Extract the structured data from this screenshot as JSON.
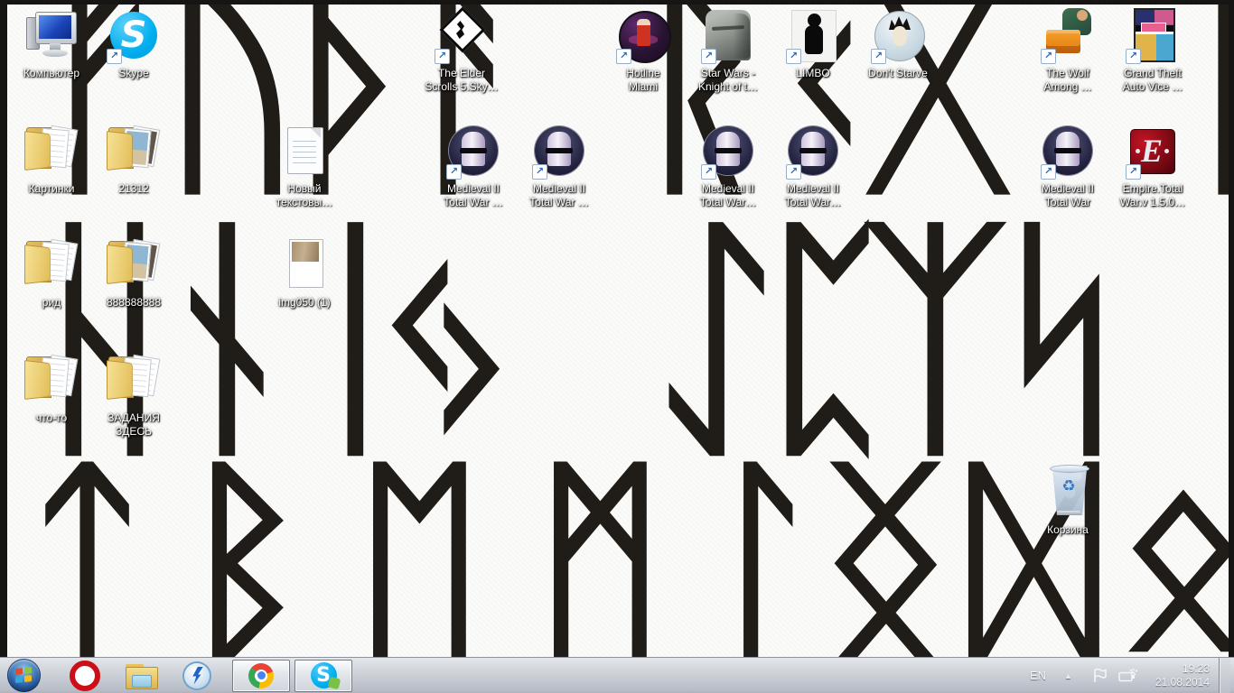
{
  "wallpaper": {
    "description": "Elder Futhark rune alphabet, black on white",
    "rune_color": "#201d18",
    "rows": [
      [
        "ᚠ",
        "ᚢ",
        "ᚦ",
        "ᚨ",
        "ᚱ",
        "ᚲ",
        "ᚷ",
        "ᚹ"
      ],
      [
        "ᚺ",
        "ᚾ",
        "ᛁ",
        "ᛃ",
        "ᛇ",
        "ᛈ",
        "ᛉ",
        "ᛋ"
      ],
      [
        "ᛏ",
        "ᛒ",
        "ᛖ",
        "ᛗ",
        "ᛚ",
        "ᛝ",
        "ᛞ",
        "ᛟ"
      ]
    ]
  },
  "glyphs": {
    "skype": "S",
    "empire": "E",
    "recycle": "♻",
    "shortcut": "↗"
  },
  "desktop": {
    "icons": [
      {
        "label": "Компьютер",
        "type": "computer",
        "shortcut": false
      },
      {
        "label": "Skype",
        "type": "skype",
        "shortcut": true
      },
      {
        "label": "The Elder\nScrolls 5.Sky…",
        "type": "skyrim",
        "shortcut": true
      },
      {
        "label": "Hotline\nMiami",
        "type": "hotline-miami",
        "shortcut": true
      },
      {
        "label": "Star Wars -\nKnight of t…",
        "type": "kotor",
        "shortcut": true
      },
      {
        "label": "LIMBO",
        "type": "limbo",
        "shortcut": true
      },
      {
        "label": "Don't Starve",
        "type": "dont-starve",
        "shortcut": true
      },
      {
        "label": "The Wolf\nAmong …",
        "type": "wolf-among-us",
        "shortcut": true
      },
      {
        "label": "Grand Theft\nAuto Vice …",
        "type": "gta-vice-city",
        "shortcut": true
      },
      {
        "label": "Картинки",
        "type": "folder-docs",
        "shortcut": false
      },
      {
        "label": "21312",
        "type": "folder-photos",
        "shortcut": false
      },
      {
        "label": "Новый\nтекстовы…",
        "type": "text-file",
        "shortcut": false
      },
      {
        "label": "Medieval II\nTotal War …",
        "type": "medieval2",
        "shortcut": true
      },
      {
        "label": "Medieval II\nTotal War …",
        "type": "medieval2",
        "shortcut": true
      },
      {
        "label": "Medieval II\nTotal War…",
        "type": "medieval2",
        "shortcut": true
      },
      {
        "label": "Medieval II\nTotal War…",
        "type": "medieval2",
        "shortcut": true
      },
      {
        "label": "Medieval II\nTotal War",
        "type": "medieval2",
        "shortcut": true
      },
      {
        "label": "Empire.Total\nWar.v 1.5.0…",
        "type": "empire-total-war",
        "shortcut": true
      },
      {
        "label": "рид",
        "type": "folder-docs",
        "shortcut": false
      },
      {
        "label": "888888888",
        "type": "folder-photos",
        "shortcut": false
      },
      {
        "label": "img050 (1)",
        "type": "image-file",
        "shortcut": false
      },
      {
        "label": "что-то",
        "type": "folder-docs",
        "shortcut": false
      },
      {
        "label": "ЗАДАНИЯ\nЗДЕСЬ",
        "type": "folder-docs",
        "shortcut": false
      },
      {
        "label": "Корзина",
        "type": "recycle-bin",
        "shortcut": false
      }
    ]
  },
  "taskbar": {
    "buttons": [
      {
        "name": "start"
      },
      {
        "name": "opera"
      },
      {
        "name": "windows-explorer"
      },
      {
        "name": "daemon-tools"
      },
      {
        "name": "google-chrome",
        "open": true
      },
      {
        "name": "skype",
        "open": true
      }
    ],
    "tray": {
      "language": "EN",
      "time": "19:23",
      "date": "21.08.2014"
    }
  }
}
